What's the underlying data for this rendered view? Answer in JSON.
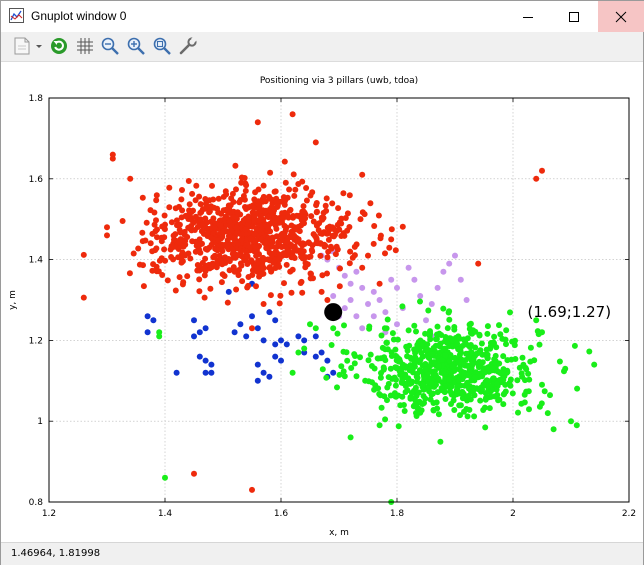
{
  "window": {
    "title": "Gnuplot window 0"
  },
  "toolbar": {
    "icons": [
      "export-icon",
      "replot-icon",
      "grid-icon",
      "zoom-out-icon",
      "zoom-in-icon",
      "zoom-fit-icon",
      "settings-wrench-icon"
    ]
  },
  "status": {
    "coordinates": "1.46964,  1.81998"
  },
  "colors": {
    "red": "#ee2a0c",
    "green": "#19ee19",
    "blue": "#1133d0",
    "violet": "#c796ec",
    "black": "#000000"
  },
  "chart_data": {
    "type": "scatter",
    "title": "Positioning via 3 pillars (uwb, tdoa)",
    "xlabel": "x, m",
    "ylabel": "y, m",
    "xlim": [
      1.2,
      2.2
    ],
    "ylim": [
      0.8,
      1.8
    ],
    "xticks": [
      "1.2",
      "1.4",
      "1.6",
      "1.8",
      "2",
      "2.2"
    ],
    "yticks": [
      "0.8",
      "1",
      "1.2",
      "1.4",
      "1.6",
      "1.8"
    ],
    "grid": true,
    "series": [
      {
        "color": "red",
        "cluster": {
          "center": [
            1.55,
            1.46
          ],
          "spread": [
            0.085,
            0.055
          ],
          "count": 900
        },
        "points": [
          [
            1.31,
            1.66
          ],
          [
            1.31,
            1.65
          ],
          [
            1.56,
            1.74
          ],
          [
            1.62,
            1.76
          ],
          [
            1.66,
            1.69
          ],
          [
            1.74,
            1.61
          ],
          [
            1.3,
            1.48
          ],
          [
            1.3,
            1.46
          ],
          [
            1.34,
            1.6
          ],
          [
            2.05,
            1.62
          ],
          [
            2.04,
            1.6
          ],
          [
            1.94,
            1.39
          ],
          [
            1.45,
            0.87
          ],
          [
            1.55,
            0.83
          ],
          [
            1.55,
            1.23
          ],
          [
            1.57,
            1.29
          ],
          [
            1.75,
            1.41
          ],
          [
            1.74,
            1.38
          ],
          [
            1.77,
            1.34
          ],
          [
            1.79,
            1.45
          ],
          [
            1.67,
            1.32
          ],
          [
            1.68,
            1.3
          ]
        ]
      },
      {
        "color": "green",
        "cluster": {
          "center": [
            1.89,
            1.13
          ],
          "spread": [
            0.075,
            0.055
          ],
          "count": 700
        },
        "points": [
          [
            1.4,
            0.86
          ],
          [
            1.79,
            0.8
          ],
          [
            2.14,
            1.14
          ],
          [
            2.1,
            1.0
          ],
          [
            2.11,
            0.99
          ],
          [
            2.07,
            0.98
          ],
          [
            2.06,
            1.02
          ],
          [
            1.39,
            1.21
          ],
          [
            1.39,
            1.22
          ],
          [
            1.65,
            1.24
          ],
          [
            1.66,
            1.23
          ],
          [
            1.69,
            1.23
          ],
          [
            1.64,
            1.18
          ],
          [
            1.63,
            1.17
          ],
          [
            1.62,
            1.12
          ],
          [
            1.72,
            0.96
          ],
          [
            1.77,
            0.99
          ],
          [
            2.04,
            1.25
          ],
          [
            2.05,
            1.22
          ],
          [
            2.09,
            1.13
          ]
        ]
      },
      {
        "color": "blue",
        "points": [
          [
            1.37,
            1.26
          ],
          [
            1.38,
            1.25
          ],
          [
            1.37,
            1.22
          ],
          [
            1.45,
            1.25
          ],
          [
            1.45,
            1.21
          ],
          [
            1.46,
            1.22
          ],
          [
            1.47,
            1.23
          ],
          [
            1.46,
            1.16
          ],
          [
            1.47,
            1.15
          ],
          [
            1.48,
            1.14
          ],
          [
            1.48,
            1.12
          ],
          [
            1.42,
            1.12
          ],
          [
            1.47,
            1.12
          ],
          [
            1.52,
            1.22
          ],
          [
            1.54,
            1.21
          ],
          [
            1.53,
            1.24
          ],
          [
            1.55,
            1.26
          ],
          [
            1.56,
            1.23
          ],
          [
            1.58,
            1.27
          ],
          [
            1.59,
            1.25
          ],
          [
            1.57,
            1.2
          ],
          [
            1.59,
            1.19
          ],
          [
            1.6,
            1.2
          ],
          [
            1.59,
            1.16
          ],
          [
            1.6,
            1.15
          ],
          [
            1.61,
            1.19
          ],
          [
            1.56,
            1.14
          ],
          [
            1.57,
            1.12
          ],
          [
            1.56,
            1.1
          ],
          [
            1.58,
            1.11
          ],
          [
            1.63,
            1.21
          ],
          [
            1.64,
            1.2
          ],
          [
            1.66,
            1.21
          ],
          [
            1.67,
            1.17
          ],
          [
            1.66,
            1.16
          ],
          [
            1.68,
            1.15
          ],
          [
            1.69,
            1.12
          ],
          [
            1.68,
            1.11
          ],
          [
            1.64,
            1.17
          ],
          [
            1.5,
            1.4
          ],
          [
            1.55,
            1.34
          ],
          [
            1.51,
            1.32
          ]
        ]
      },
      {
        "color": "violet",
        "points": [
          [
            1.67,
            1.41
          ],
          [
            1.68,
            1.4
          ],
          [
            1.69,
            1.42
          ],
          [
            1.7,
            1.38
          ],
          [
            1.71,
            1.36
          ],
          [
            1.72,
            1.34
          ],
          [
            1.73,
            1.37
          ],
          [
            1.74,
            1.33
          ],
          [
            1.72,
            1.3
          ],
          [
            1.71,
            1.28
          ],
          [
            1.69,
            1.31
          ],
          [
            1.7,
            1.26
          ],
          [
            1.73,
            1.26
          ],
          [
            1.75,
            1.29
          ],
          [
            1.76,
            1.32
          ],
          [
            1.77,
            1.3
          ],
          [
            1.78,
            1.27
          ],
          [
            1.79,
            1.35
          ],
          [
            1.8,
            1.33
          ],
          [
            1.81,
            1.28
          ],
          [
            1.82,
            1.38
          ],
          [
            1.83,
            1.35
          ],
          [
            1.84,
            1.31
          ],
          [
            1.85,
            1.25
          ],
          [
            1.86,
            1.29
          ],
          [
            1.87,
            1.33
          ],
          [
            1.88,
            1.37
          ],
          [
            1.89,
            1.39
          ],
          [
            1.9,
            1.41
          ],
          [
            1.91,
            1.35
          ],
          [
            1.92,
            1.3
          ],
          [
            1.86,
            1.21
          ],
          [
            1.76,
            1.26
          ],
          [
            1.74,
            1.23
          ],
          [
            1.78,
            1.22
          ],
          [
            1.8,
            1.24
          ]
        ]
      },
      {
        "color": "black",
        "marker": "large",
        "points": [
          [
            1.69,
            1.27
          ]
        ]
      }
    ],
    "annotations": [
      {
        "text": "(1.69;1.27)",
        "x": 2.025,
        "y": 1.27
      }
    ]
  }
}
